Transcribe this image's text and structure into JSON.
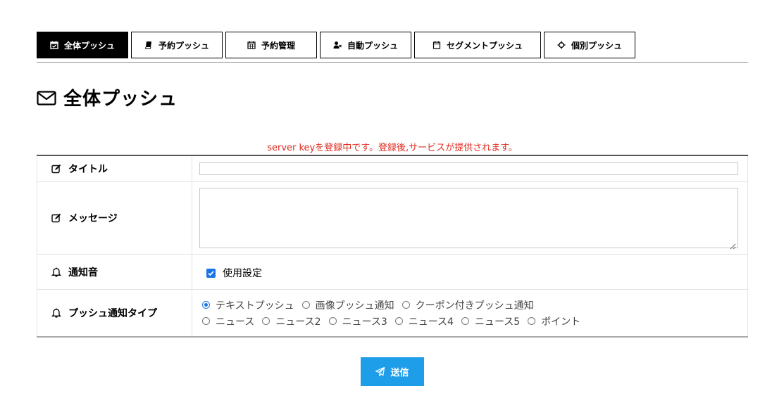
{
  "tabs": [
    {
      "label": "全体プッシュ",
      "icon": "calendar-check-icon",
      "active": true
    },
    {
      "label": "予約プッシュ",
      "icon": "book-icon",
      "active": false
    },
    {
      "label": "予約管理",
      "icon": "calendar-grid-icon",
      "active": false
    },
    {
      "label": "自動プッシュ",
      "icon": "user-x-icon",
      "active": false
    },
    {
      "label": "セグメントプッシュ",
      "icon": "calendar-icon",
      "active": false
    },
    {
      "label": "個別プッシュ",
      "icon": "crosshair-icon",
      "active": false
    }
  ],
  "page": {
    "title": "全体プッシュ",
    "title_icon": "envelope-icon",
    "notice": "server keyを登録中です。登録後,サービスが提供されます。"
  },
  "form": {
    "title_label": "タイトル",
    "title_value": "",
    "message_label": "メッセージ",
    "message_value": "",
    "sound_label": "通知音",
    "sound_checkbox_label": "使用設定",
    "sound_checked": true,
    "type_label": "プッシュ通知タイプ",
    "type_options_line1": [
      "テキストプッシュ",
      "画像プッシュ通知",
      "クーポン付きプッシュ通知"
    ],
    "type_options_line2": [
      "ニュース",
      "ニュース2",
      "ニュース3",
      "ニュース4",
      "ニュース5",
      "ポイント"
    ],
    "type_selected": "テキストプッシュ"
  },
  "submit": {
    "label": "送信",
    "icon": "paper-plane-icon"
  },
  "colors": {
    "accent": "#1e9de8",
    "notice": "#e02b20",
    "checkbox": "#1a73e8"
  }
}
